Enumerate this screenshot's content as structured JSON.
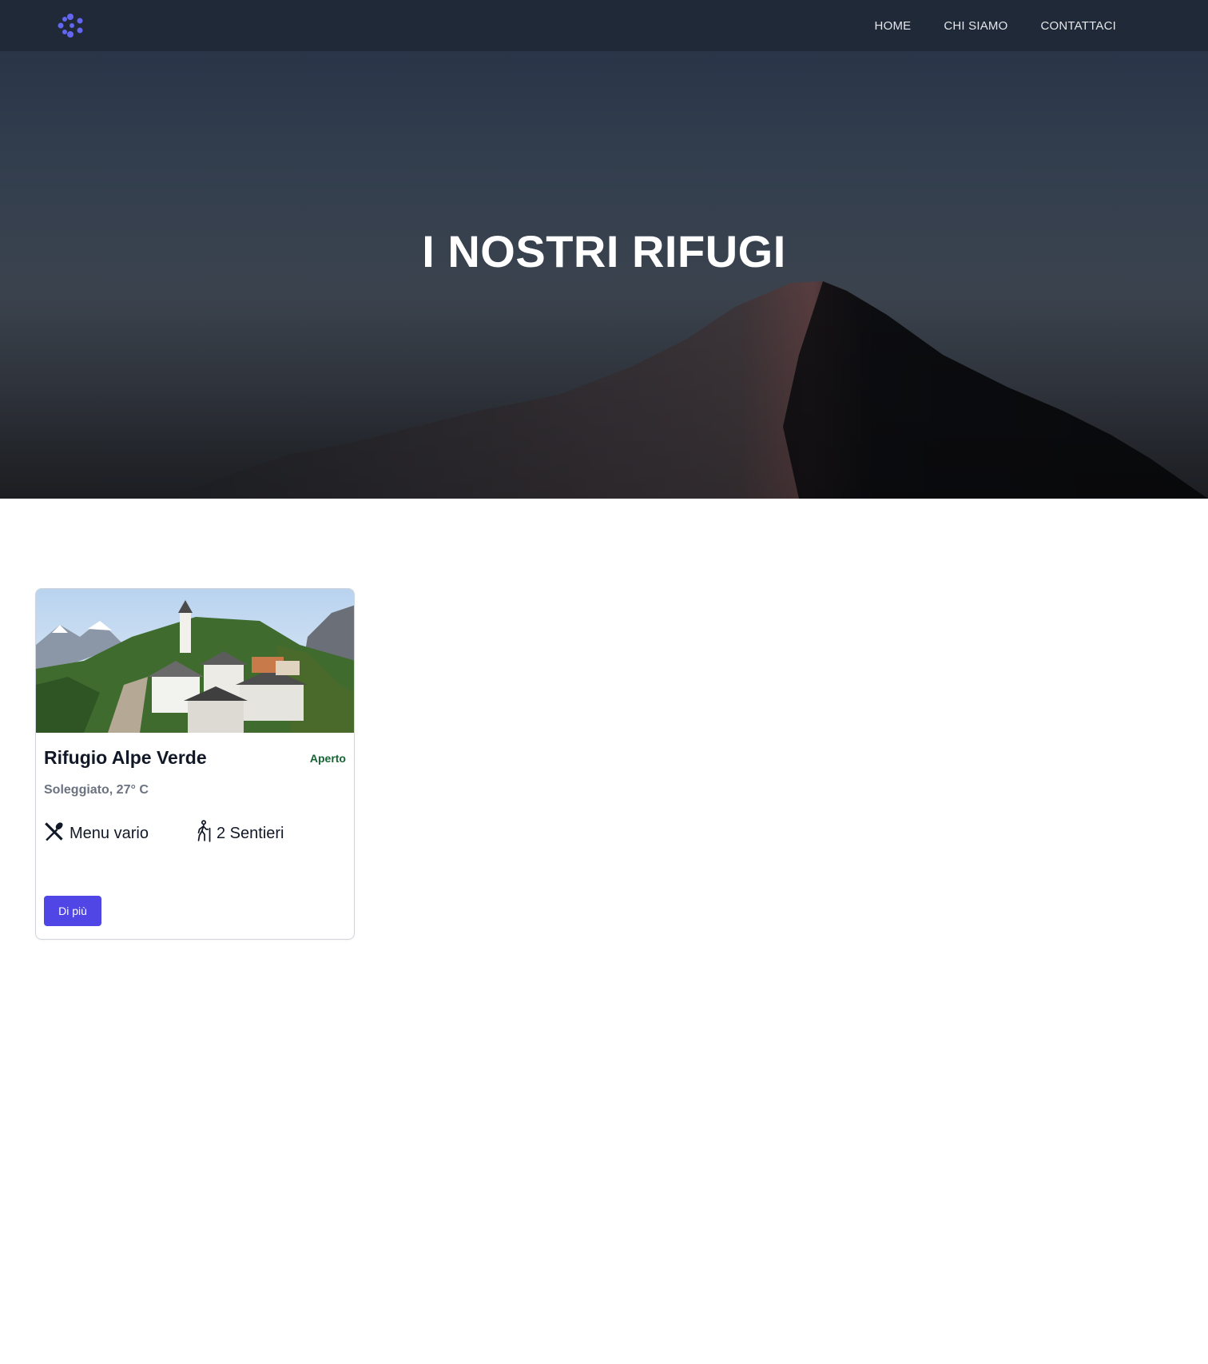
{
  "navbar": {
    "logo_icon": "dots-logo-icon",
    "links": [
      {
        "label": "HOME"
      },
      {
        "label": "CHI SIAMO"
      },
      {
        "label": "CONTATTACI"
      }
    ]
  },
  "hero": {
    "title": "I NOSTRI RIFUGI",
    "background": "mountain-photo"
  },
  "cards": [
    {
      "title": "Rifugio Alpe Verde",
      "status": "Aperto",
      "weather": "Soleggiato, 27° C",
      "features": [
        {
          "icon": "utensils-icon",
          "label": "Menu vario"
        },
        {
          "icon": "hiker-icon",
          "label": "2 Sentieri"
        }
      ],
      "button_label": "Di più",
      "image": "alpine-village-photo"
    }
  ],
  "colors": {
    "navbar_bg": "#1f2937",
    "accent": "#4f46e5",
    "status_open": "#166534",
    "muted_text": "#6b7280"
  }
}
